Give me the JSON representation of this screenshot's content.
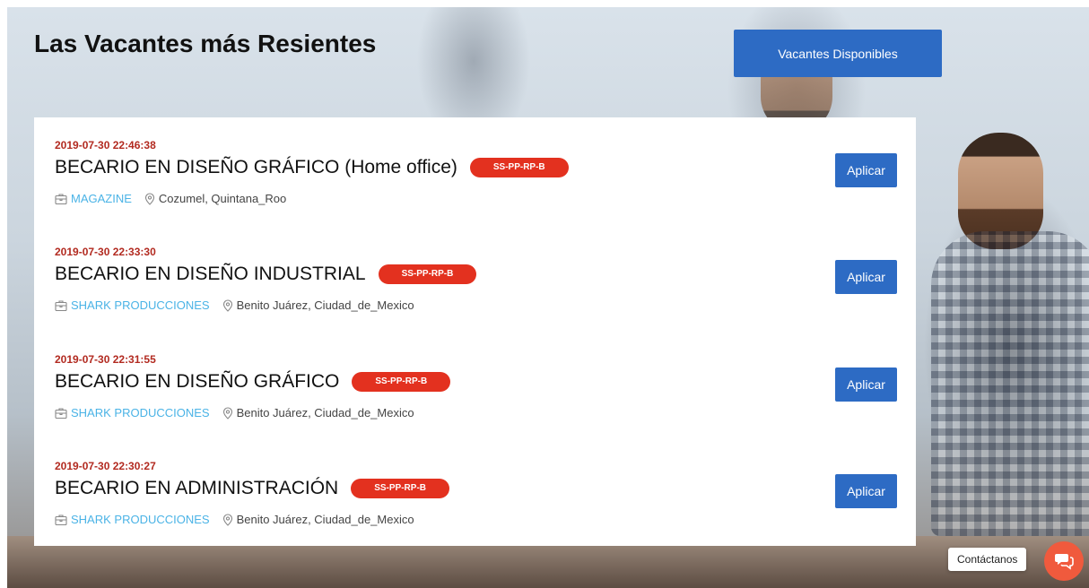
{
  "section": {
    "title": "Las Vacantes más Resientes",
    "cta_label": "Vacantes Disponibles"
  },
  "jobs": [
    {
      "date": "2019-07-30 22:46:38",
      "title": "BECARIO EN DISEÑO GRÁFICO (Home office)",
      "badge": "SS-PP-RP-B",
      "company": "MAGAZINE",
      "location": "Cozumel, Quintana_Roo",
      "apply_label": "Aplicar"
    },
    {
      "date": "2019-07-30 22:33:30",
      "title": "BECARIO EN DISEÑO INDUSTRIAL",
      "badge": "SS-PP-RP-B",
      "company": "SHARK PRODUCCIONES",
      "location": "Benito Juárez, Ciudad_de_Mexico",
      "apply_label": "Aplicar"
    },
    {
      "date": "2019-07-30 22:31:55",
      "title": "BECARIO EN DISEÑO GRÁFICO",
      "badge": "SS-PP-RP-B",
      "company": "SHARK PRODUCCIONES",
      "location": "Benito Juárez, Ciudad_de_Mexico",
      "apply_label": "Aplicar"
    },
    {
      "date": "2019-07-30 22:30:27",
      "title": "BECARIO EN ADMINISTRACIÓN",
      "badge": "SS-PP-RP-B",
      "company": "SHARK PRODUCCIONES",
      "location": "Benito Juárez, Ciudad_de_Mexico",
      "apply_label": "Aplicar"
    }
  ],
  "contact": {
    "label": "Contáctanos",
    "icon": "chat-icon"
  },
  "colors": {
    "primary_button": "#2d6bc4",
    "badge": "#e3311f",
    "date": "#b22a20",
    "company_link": "#4ab3e6",
    "contact_button": "#f05a3d"
  }
}
